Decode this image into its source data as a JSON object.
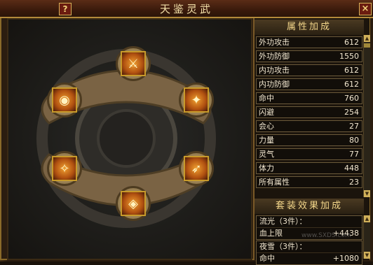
{
  "window": {
    "title": "天鉴灵武",
    "help_label": "?",
    "close_label": "×"
  },
  "slots": [
    {
      "name": "spear",
      "icon": "spear-icon",
      "glyph": "⚔"
    },
    {
      "name": "amulet",
      "icon": "amulet-icon",
      "glyph": "◉"
    },
    {
      "name": "armor",
      "icon": "armor-icon",
      "glyph": "✦"
    },
    {
      "name": "sword",
      "icon": "sword-icon",
      "glyph": "✧"
    },
    {
      "name": "bow",
      "icon": "bow-icon",
      "glyph": "➶"
    },
    {
      "name": "belt",
      "icon": "belt-icon",
      "glyph": "◈"
    }
  ],
  "panel": {
    "attr_header": "属性加成",
    "attributes": [
      {
        "name": "外功攻击",
        "value": "612"
      },
      {
        "name": "外功防御",
        "value": "1550"
      },
      {
        "name": "内功攻击",
        "value": "612"
      },
      {
        "name": "内功防御",
        "value": "612"
      },
      {
        "name": "命中",
        "value": "760"
      },
      {
        "name": "闪避",
        "value": "254"
      },
      {
        "name": "会心",
        "value": "27"
      },
      {
        "name": "力量",
        "value": "80"
      },
      {
        "name": "灵气",
        "value": "77"
      },
      {
        "name": "体力",
        "value": "448"
      },
      {
        "name": "所有属性",
        "value": "23"
      }
    ],
    "set_header": "套装效果加成",
    "sets": [
      {
        "name": "流光（3件）：",
        "bonus_name": "血上限",
        "bonus_value": "+4438"
      },
      {
        "name": "夜雪（3件）：",
        "bonus_name": "命中",
        "bonus_value": "+1080"
      }
    ]
  },
  "watermark": "www.SXDS.com"
}
